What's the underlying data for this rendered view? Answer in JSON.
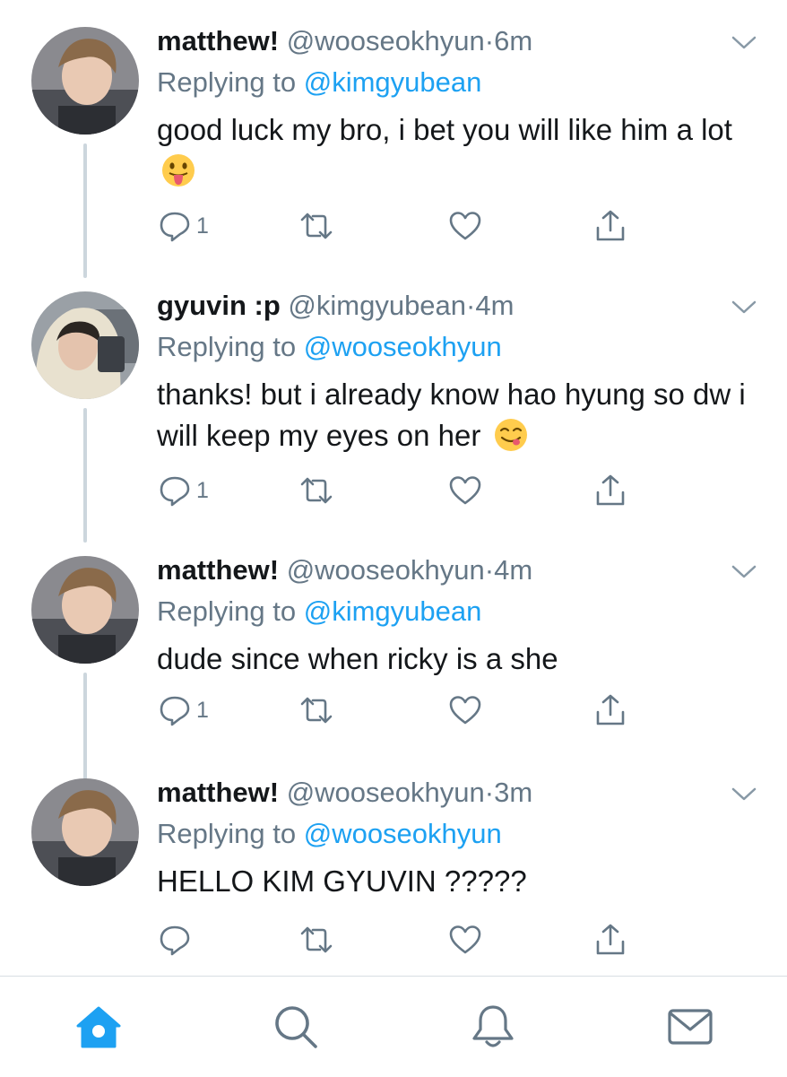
{
  "tweets": [
    {
      "name": "matthew!",
      "handle": "@wooseokhyun",
      "time": "6m",
      "reply_prefix": "Replying to",
      "reply_to": "@kimgyubean",
      "text": "good luck my bro, i bet you will like him a lot",
      "emoji": "tongue-out-face",
      "reply_count": "1"
    },
    {
      "name": "gyuvin :p",
      "handle": "@kimgyubean",
      "time": "4m",
      "reply_prefix": "Replying to",
      "reply_to": "@wooseokhyun",
      "text": "thanks! but i already know hao hyung so dw i will keep my eyes on her",
      "emoji": "yum-face",
      "reply_count": "1"
    },
    {
      "name": "matthew!",
      "handle": "@wooseokhyun",
      "time": "4m",
      "reply_prefix": "Replying to",
      "reply_to": "@kimgyubean",
      "text": "dude since when ricky is a she",
      "emoji": "",
      "reply_count": "1"
    },
    {
      "name": "matthew!",
      "handle": "@wooseokhyun",
      "time": "3m",
      "reply_prefix": "Replying to",
      "reply_to": "@wooseokhyun",
      "text": "HELLO KIM GYUVIN ?????",
      "emoji": "",
      "reply_count": ""
    }
  ],
  "separator": "·",
  "tabbar": {
    "active_tab": "home",
    "tabs": [
      "home-icon",
      "search-icon",
      "notifications-icon",
      "messages-icon"
    ],
    "active_color": "#1da1f2",
    "inactive_color": "#657786"
  },
  "colors": {
    "link": "#1da1f2",
    "secondary": "#657786",
    "thread_line": "#ccd6dd"
  }
}
